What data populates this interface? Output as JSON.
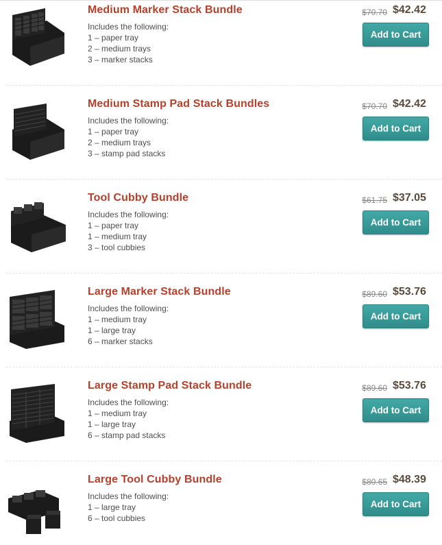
{
  "products": [
    {
      "title": "Medium Marker Stack Bundle",
      "includes_label": "Includes the following:",
      "items": [
        "1 – paper tray",
        "2 – medium trays",
        "3 – marker stacks"
      ],
      "old_price": "$70.70",
      "price": "$42.42",
      "button_label": "Add to Cart",
      "image_icon": "organizer-marker-stack-icon"
    },
    {
      "title": "Medium Stamp Pad Stack Bundles",
      "includes_label": "Includes the following:",
      "items": [
        "1 – paper tray",
        "2 – medium trays",
        "3 – stamp pad stacks"
      ],
      "old_price": "$70.70",
      "price": "$42.42",
      "button_label": "Add to Cart",
      "image_icon": "organizer-stamp-pad-stack-icon"
    },
    {
      "title": "Tool Cubby Bundle",
      "includes_label": "Includes the following:",
      "items": [
        "1 – paper tray",
        "1 – medium tray",
        "3 – tool cubbies"
      ],
      "old_price": "$61.75",
      "price": "$37.05",
      "button_label": "Add to Cart",
      "image_icon": "organizer-tool-cubby-icon"
    },
    {
      "title": "Large Marker Stack Bundle",
      "includes_label": "Includes the following:",
      "items": [
        "1 – medium tray",
        "1 – large tray",
        "6 – marker stacks"
      ],
      "old_price": "$89.60",
      "price": "$53.76",
      "button_label": "Add to Cart",
      "image_icon": "organizer-large-marker-stack-icon"
    },
    {
      "title": "Large Stamp Pad Stack Bundle",
      "includes_label": "Includes the following:",
      "items": [
        "1 – medium tray",
        "1 – large tray",
        "6 – stamp pad stacks"
      ],
      "old_price": "$89.60",
      "price": "$53.76",
      "button_label": "Add to Cart",
      "image_icon": "organizer-large-stamp-pad-stack-icon"
    },
    {
      "title": "Large Tool Cubby Bundle",
      "includes_label": "Includes the following:",
      "items": [
        "1 – large tray",
        "6 – tool cubbies"
      ],
      "old_price": "$80.65",
      "price": "$48.39",
      "button_label": "Add to Cart",
      "image_icon": "organizer-large-tool-cubby-icon"
    }
  ],
  "colors": {
    "title": "#b5402b",
    "price": "#5a4a3c",
    "button": "#3a9c99"
  }
}
